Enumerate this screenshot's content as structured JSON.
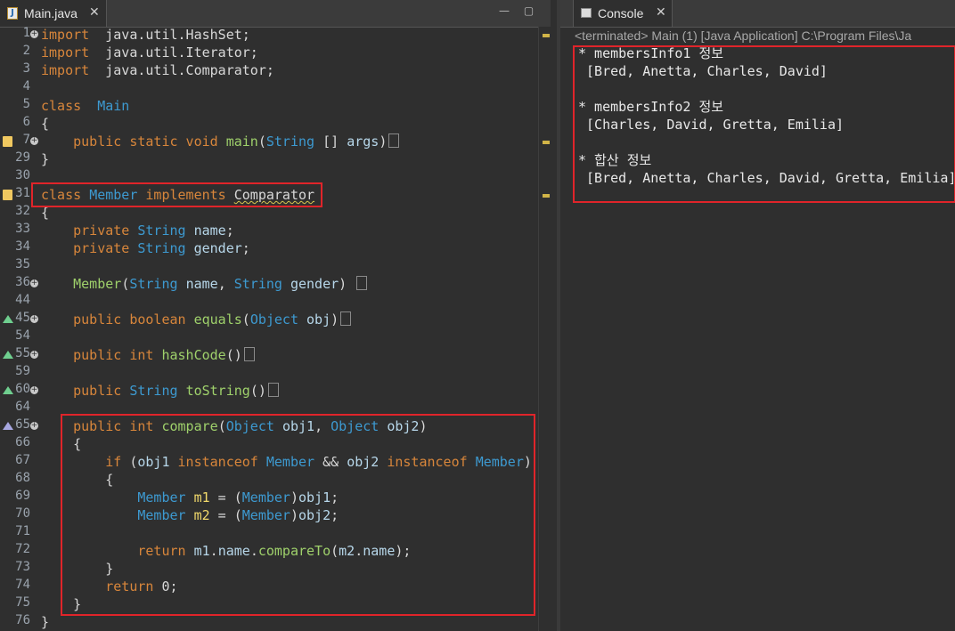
{
  "editor": {
    "tab_label": "Main.java",
    "lines": [
      {
        "n": "1",
        "fold": true,
        "mark": "",
        "tokens": [
          [
            "kw",
            "import"
          ],
          [
            "",
            "  java.util.HashSet;"
          ]
        ]
      },
      {
        "n": "2",
        "fold": false,
        "mark": "",
        "tokens": [
          [
            "kw",
            "import"
          ],
          [
            "",
            "  java.util.Iterator;"
          ]
        ]
      },
      {
        "n": "3",
        "fold": false,
        "mark": "",
        "tokens": [
          [
            "kw",
            "import"
          ],
          [
            "",
            "  java.util.Comparator;"
          ]
        ]
      },
      {
        "n": "4",
        "fold": false,
        "mark": "",
        "tokens": []
      },
      {
        "n": "5",
        "fold": false,
        "mark": "",
        "tokens": [
          [
            "kw",
            "class"
          ],
          [
            "",
            "  "
          ],
          [
            "ty",
            "Main"
          ]
        ]
      },
      {
        "n": "6",
        "fold": false,
        "mark": "",
        "tokens": [
          [
            "",
            "{"
          ]
        ]
      },
      {
        "n": "7",
        "fold": true,
        "mark": "doc",
        "tokens": [
          [
            "",
            "    "
          ],
          [
            "kw",
            "public static void"
          ],
          [
            "",
            " "
          ],
          [
            "fn",
            "main"
          ],
          [
            "",
            "("
          ],
          [
            "ty",
            "String"
          ],
          [
            "",
            " [] "
          ],
          [
            "va",
            "args"
          ],
          [
            "",
            ")"
          ],
          [
            "el",
            ""
          ]
        ]
      },
      {
        "n": "29",
        "fold": false,
        "mark": "",
        "tokens": [
          [
            "",
            "}"
          ]
        ]
      },
      {
        "n": "30",
        "fold": false,
        "mark": "",
        "tokens": []
      },
      {
        "n": "31",
        "fold": false,
        "mark": "doc",
        "tokens": [
          [
            "kw",
            "class"
          ],
          [
            "",
            " "
          ],
          [
            "ty",
            "Member"
          ],
          [
            "",
            " "
          ],
          [
            "kw",
            "implements"
          ],
          [
            "",
            " "
          ],
          [
            "ul",
            "Comparator"
          ]
        ]
      },
      {
        "n": "32",
        "fold": false,
        "mark": "",
        "tokens": [
          [
            "",
            "{"
          ]
        ]
      },
      {
        "n": "33",
        "fold": false,
        "mark": "",
        "tokens": [
          [
            "",
            "    "
          ],
          [
            "kw",
            "private"
          ],
          [
            "",
            " "
          ],
          [
            "ty",
            "String"
          ],
          [
            "",
            " "
          ],
          [
            "va",
            "name"
          ],
          [
            "",
            ";"
          ]
        ]
      },
      {
        "n": "34",
        "fold": false,
        "mark": "",
        "tokens": [
          [
            "",
            "    "
          ],
          [
            "kw",
            "private"
          ],
          [
            "",
            " "
          ],
          [
            "ty",
            "String"
          ],
          [
            "",
            " "
          ],
          [
            "va",
            "gender"
          ],
          [
            "",
            ";"
          ]
        ]
      },
      {
        "n": "35",
        "fold": false,
        "mark": "",
        "tokens": []
      },
      {
        "n": "36",
        "fold": true,
        "mark": "",
        "tokens": [
          [
            "",
            "    "
          ],
          [
            "fn",
            "Member"
          ],
          [
            "",
            "("
          ],
          [
            "ty",
            "String"
          ],
          [
            "",
            " "
          ],
          [
            "va",
            "name"
          ],
          [
            "",
            ", "
          ],
          [
            "ty",
            "String"
          ],
          [
            "",
            " "
          ],
          [
            "va",
            "gender"
          ],
          [
            "",
            ") "
          ],
          [
            "el",
            ""
          ]
        ]
      },
      {
        "n": "44",
        "fold": false,
        "mark": "",
        "tokens": []
      },
      {
        "n": "45",
        "fold": true,
        "mark": "up",
        "tokens": [
          [
            "",
            "    "
          ],
          [
            "kw",
            "public boolean"
          ],
          [
            "",
            " "
          ],
          [
            "fn",
            "equals"
          ],
          [
            "",
            "("
          ],
          [
            "ty",
            "Object"
          ],
          [
            "",
            " "
          ],
          [
            "va",
            "obj"
          ],
          [
            "",
            ")"
          ],
          [
            "el",
            ""
          ]
        ]
      },
      {
        "n": "54",
        "fold": false,
        "mark": "",
        "tokens": []
      },
      {
        "n": "55",
        "fold": true,
        "mark": "up",
        "tokens": [
          [
            "",
            "    "
          ],
          [
            "kw",
            "public int"
          ],
          [
            "",
            " "
          ],
          [
            "fn",
            "hashCode"
          ],
          [
            "",
            "()"
          ],
          [
            "el",
            ""
          ]
        ]
      },
      {
        "n": "59",
        "fold": false,
        "mark": "",
        "tokens": []
      },
      {
        "n": "60",
        "fold": true,
        "mark": "up",
        "tokens": [
          [
            "",
            "    "
          ],
          [
            "kw",
            "public"
          ],
          [
            "",
            " "
          ],
          [
            "ty",
            "String"
          ],
          [
            "",
            " "
          ],
          [
            "fn",
            "toString"
          ],
          [
            "",
            "()"
          ],
          [
            "el",
            ""
          ]
        ]
      },
      {
        "n": "64",
        "fold": false,
        "mark": "",
        "tokens": []
      },
      {
        "n": "65",
        "fold": true,
        "mark": "upd",
        "tokens": [
          [
            "",
            "    "
          ],
          [
            "kw",
            "public int"
          ],
          [
            "",
            " "
          ],
          [
            "fn",
            "compare"
          ],
          [
            "",
            "("
          ],
          [
            "ty",
            "Object"
          ],
          [
            "",
            " "
          ],
          [
            "va",
            "obj1"
          ],
          [
            "",
            ", "
          ],
          [
            "ty",
            "Object"
          ],
          [
            "",
            " "
          ],
          [
            "va",
            "obj2"
          ],
          [
            "",
            ")"
          ]
        ]
      },
      {
        "n": "66",
        "fold": false,
        "mark": "",
        "tokens": [
          [
            "",
            "    {"
          ]
        ]
      },
      {
        "n": "67",
        "fold": false,
        "mark": "",
        "tokens": [
          [
            "",
            "        "
          ],
          [
            "kw",
            "if"
          ],
          [
            "",
            " ("
          ],
          [
            "va",
            "obj1"
          ],
          [
            "",
            " "
          ],
          [
            "kw",
            "instanceof"
          ],
          [
            "",
            " "
          ],
          [
            "ty",
            "Member"
          ],
          [
            "",
            " && "
          ],
          [
            "va",
            "obj2"
          ],
          [
            "",
            " "
          ],
          [
            "kw",
            "instanceof"
          ],
          [
            "",
            " "
          ],
          [
            "ty",
            "Member"
          ],
          [
            "",
            ")"
          ]
        ]
      },
      {
        "n": "68",
        "fold": false,
        "mark": "",
        "tokens": [
          [
            "",
            "        {"
          ]
        ]
      },
      {
        "n": "69",
        "fold": false,
        "mark": "",
        "tokens": [
          [
            "",
            "            "
          ],
          [
            "ty",
            "Member"
          ],
          [
            "",
            " "
          ],
          [
            "fd",
            "m1"
          ],
          [
            "",
            " = ("
          ],
          [
            "ty",
            "Member"
          ],
          [
            "",
            ")"
          ],
          [
            "va",
            "obj1"
          ],
          [
            "",
            ";"
          ]
        ]
      },
      {
        "n": "70",
        "fold": false,
        "mark": "",
        "tokens": [
          [
            "",
            "            "
          ],
          [
            "ty",
            "Member"
          ],
          [
            "",
            " "
          ],
          [
            "fd",
            "m2"
          ],
          [
            "",
            " = ("
          ],
          [
            "ty",
            "Member"
          ],
          [
            "",
            ")"
          ],
          [
            "va",
            "obj2"
          ],
          [
            "",
            ";"
          ]
        ]
      },
      {
        "n": "71",
        "fold": false,
        "mark": "",
        "tokens": []
      },
      {
        "n": "72",
        "fold": false,
        "mark": "",
        "tokens": [
          [
            "",
            "            "
          ],
          [
            "kw",
            "return"
          ],
          [
            "",
            " "
          ],
          [
            "va",
            "m1"
          ],
          [
            "",
            "."
          ],
          [
            "va",
            "name"
          ],
          [
            "",
            "."
          ],
          [
            "fn",
            "compareTo"
          ],
          [
            "",
            "("
          ],
          [
            "va",
            "m2"
          ],
          [
            "",
            "."
          ],
          [
            "va",
            "name"
          ],
          [
            "",
            ");"
          ]
        ]
      },
      {
        "n": "73",
        "fold": false,
        "mark": "",
        "tokens": [
          [
            "",
            "        }"
          ]
        ]
      },
      {
        "n": "74",
        "fold": false,
        "mark": "",
        "tokens": [
          [
            "",
            "        "
          ],
          [
            "kw",
            "return"
          ],
          [
            "",
            " 0;"
          ]
        ]
      },
      {
        "n": "75",
        "fold": false,
        "mark": "",
        "tokens": [
          [
            "",
            "    }"
          ]
        ]
      },
      {
        "n": "76",
        "fold": false,
        "mark": "",
        "tokens": [
          [
            "",
            "}"
          ]
        ]
      }
    ]
  },
  "console": {
    "tab_label": "Console",
    "status": "<terminated> Main (1) [Java Application] C:\\Program Files\\Ja",
    "lines": [
      "* membersInfo1 정보",
      " [Bred, Anetta, Charles, David]",
      "",
      "* membersInfo2 정보",
      " [Charles, David, Gretta, Emilia]",
      "",
      "* 합산 정보",
      " [Bred, Anetta, Charles, David, Gretta, Emilia]"
    ]
  },
  "colors": {
    "highlight": "#e0242a",
    "background": "#2f2f2f",
    "keyword": "#d8863b",
    "type": "#3d9ad1"
  }
}
